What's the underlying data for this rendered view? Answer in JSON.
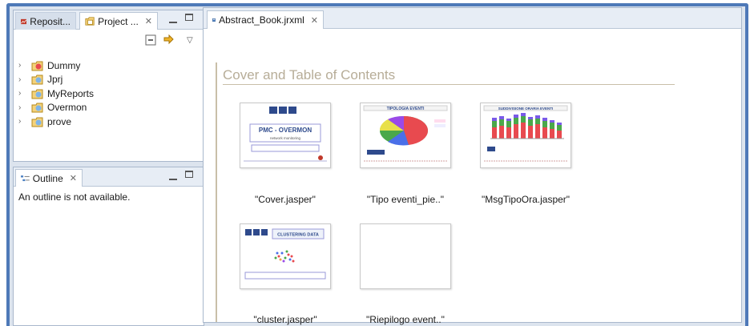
{
  "top_panel": {
    "tabs": [
      {
        "label": "Reposit...",
        "icon": "repository-icon",
        "active": false
      },
      {
        "label": "Project ...",
        "icon": "project-explorer-icon",
        "active": true
      }
    ],
    "toolbar": [
      "collapse-all-icon",
      "link-with-editor-icon",
      "view-menu-icon"
    ],
    "tree": [
      {
        "label": "Dummy",
        "icon": "jasper-project-red-icon"
      },
      {
        "label": "Jprj",
        "icon": "jasper-project-icon"
      },
      {
        "label": "MyReports",
        "icon": "jasper-project-icon"
      },
      {
        "label": "Overmon",
        "icon": "jasper-project-icon"
      },
      {
        "label": "prove",
        "icon": "jasper-project-icon"
      }
    ]
  },
  "outline_panel": {
    "tab_label": "Outline",
    "message": "An outline is not available."
  },
  "editor": {
    "tab_label": "Abstract_Book.jrxml",
    "section_title": "Cover and Table of Contents",
    "thumbnails": [
      {
        "label": "\"Cover.jasper\"",
        "title": "PMC - OVERMON",
        "subtitle": "network monitoring"
      },
      {
        "label": "\"Tipo eventi_pie..\"",
        "title": "TIPOLOGIA EVENTI"
      },
      {
        "label": "\"MsgTipoOra.jasper\"",
        "title": "SUDDIVISIONE ORARIA EVENTI"
      },
      {
        "label": "\"cluster.jasper\"",
        "title": "CLUSTERING DATA"
      },
      {
        "label": "\"Riepilogo event..\"",
        "title": ""
      }
    ]
  },
  "colors": {
    "frame": "#4e79b8",
    "section_title": "#b7ad98",
    "pie": [
      "#e84a4f",
      "#e8e04a",
      "#4aa84a",
      "#4a6fe8",
      "#9a4ae8"
    ],
    "bars": [
      "#e84a4f",
      "#4aa84a",
      "#7a5ae8"
    ]
  }
}
